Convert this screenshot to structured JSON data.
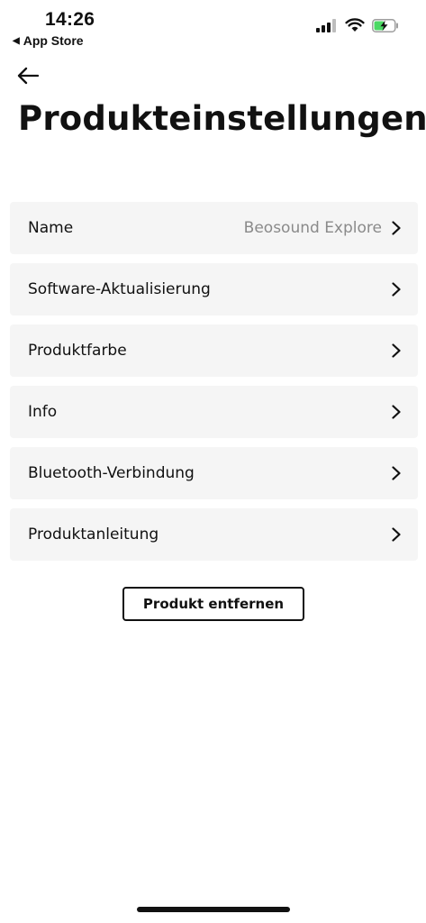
{
  "status_bar": {
    "time": "14:26",
    "back_app_label": "App Store",
    "battery_color": "#4cd964"
  },
  "header": {
    "title": "Produkteinstellungen"
  },
  "settings": {
    "name": {
      "label": "Name",
      "value": "Beosound Explore"
    },
    "software_update": {
      "label": "Software-Aktualisierung"
    },
    "product_color": {
      "label": "Produktfarbe"
    },
    "info": {
      "label": "Info"
    },
    "bluetooth": {
      "label": "Bluetooth-Verbindung"
    },
    "product_manual": {
      "label": "Produktanleitung"
    }
  },
  "actions": {
    "remove_label": "Produkt entfernen"
  },
  "icons": [
    "back-arrow-icon",
    "cellular-signal-icon",
    "wifi-icon",
    "battery-charging-icon",
    "chevron-right-icon"
  ]
}
